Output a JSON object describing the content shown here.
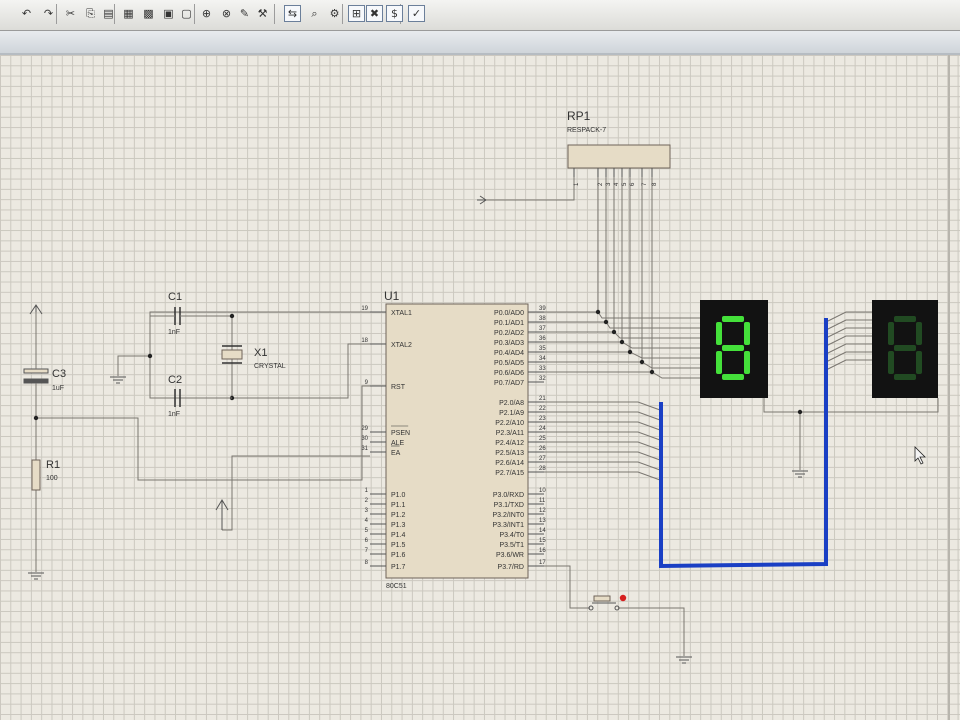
{
  "toolbar": {
    "buttons": [
      {
        "name": "undo-icon",
        "glyph": "↶"
      },
      {
        "name": "redo-icon",
        "glyph": "↷"
      },
      {
        "name": "cut-icon",
        "glyph": "✂"
      },
      {
        "name": "copy-icon",
        "glyph": "⎘"
      },
      {
        "name": "paste-icon",
        "glyph": "▤"
      },
      {
        "name": "block-copy-icon",
        "glyph": "▦"
      },
      {
        "name": "block-move-icon",
        "glyph": "▩"
      },
      {
        "name": "block-rotate-icon",
        "glyph": "▣"
      },
      {
        "name": "block-delete-icon",
        "glyph": "▢"
      },
      {
        "name": "zoom-icon",
        "glyph": "⊕"
      },
      {
        "name": "pick-device-icon",
        "glyph": "⊗"
      },
      {
        "name": "make-device-icon",
        "glyph": "✎"
      },
      {
        "name": "tools-icon",
        "glyph": "⚒"
      },
      {
        "name": "wire-autorouter-icon",
        "glyph": "⇆"
      },
      {
        "name": "search-icon",
        "glyph": "⌕"
      },
      {
        "name": "property-assignment-icon",
        "glyph": "⚙"
      },
      {
        "name": "new-sheet-icon",
        "glyph": "⊞"
      },
      {
        "name": "remove-sheet-icon",
        "glyph": "✖"
      },
      {
        "name": "bill-of-materials-icon",
        "glyph": "$"
      },
      {
        "name": "electrical-check-icon",
        "glyph": "✓"
      }
    ]
  },
  "components": {
    "rp1": {
      "ref": "RP1",
      "value": "RESPACK-7",
      "pins": [
        "1",
        "2",
        "3",
        "4",
        "5",
        "6",
        "7",
        "8"
      ]
    },
    "c1": {
      "ref": "C1",
      "value": "1nF"
    },
    "c2": {
      "ref": "C2",
      "value": "1nF"
    },
    "c3": {
      "ref": "C3",
      "value": "1uF"
    },
    "x1": {
      "ref": "X1",
      "value": "CRYSTAL"
    },
    "r1": {
      "ref": "R1",
      "value": "100"
    },
    "u1": {
      "ref": "U1",
      "part": "80C51"
    }
  },
  "u1_left_pins": [
    {
      "num": "19",
      "name": "XTAL1"
    },
    {
      "num": "18",
      "name": "XTAL2"
    },
    {
      "num": "9",
      "name": "RST"
    },
    {
      "num": "29",
      "name": "PSEN"
    },
    {
      "num": "30",
      "name": "ALE"
    },
    {
      "num": "31",
      "name": "EA"
    },
    {
      "num": "1",
      "name": "P1.0"
    },
    {
      "num": "2",
      "name": "P1.1"
    },
    {
      "num": "3",
      "name": "P1.2"
    },
    {
      "num": "4",
      "name": "P1.3"
    },
    {
      "num": "5",
      "name": "P1.4"
    },
    {
      "num": "6",
      "name": "P1.5"
    },
    {
      "num": "7",
      "name": "P1.6"
    },
    {
      "num": "8",
      "name": "P1.7"
    }
  ],
  "u1_right_pins": [
    {
      "num": "39",
      "name": "P0.0/AD0"
    },
    {
      "num": "38",
      "name": "P0.1/AD1"
    },
    {
      "num": "37",
      "name": "P0.2/AD2"
    },
    {
      "num": "36",
      "name": "P0.3/AD3"
    },
    {
      "num": "35",
      "name": "P0.4/AD4"
    },
    {
      "num": "34",
      "name": "P0.5/AD5"
    },
    {
      "num": "33",
      "name": "P0.6/AD6"
    },
    {
      "num": "32",
      "name": "P0.7/AD7"
    },
    {
      "num": "21",
      "name": "P2.0/A8"
    },
    {
      "num": "22",
      "name": "P2.1/A9"
    },
    {
      "num": "23",
      "name": "P2.2/A10"
    },
    {
      "num": "24",
      "name": "P2.3/A11"
    },
    {
      "num": "25",
      "name": "P2.4/A12"
    },
    {
      "num": "26",
      "name": "P2.5/A13"
    },
    {
      "num": "27",
      "name": "P2.6/A14"
    },
    {
      "num": "28",
      "name": "P2.7/A15"
    },
    {
      "num": "10",
      "name": "P3.0/RXD"
    },
    {
      "num": "11",
      "name": "P3.1/TXD"
    },
    {
      "num": "12",
      "name": "P3.2/INT0"
    },
    {
      "num": "13",
      "name": "P3.3/INT1"
    },
    {
      "num": "14",
      "name": "P3.4/T0"
    },
    {
      "num": "15",
      "name": "P3.5/T1"
    },
    {
      "num": "16",
      "name": "P3.6/WR"
    },
    {
      "num": "17",
      "name": "P3.7/RD"
    }
  ],
  "displays": [
    {
      "digit": "8",
      "state": "lit",
      "segment_color": "#44e03a"
    },
    {
      "digit": "8",
      "state": "unlit",
      "segment_color": "#214a22"
    }
  ],
  "colors": {
    "wire": "#7a7670",
    "bus": "#1a3fc4",
    "component_fill": "#e6dcc6",
    "component_stroke": "#6f6459",
    "display_bg": "#121212",
    "switch_dot": "#d62020"
  }
}
